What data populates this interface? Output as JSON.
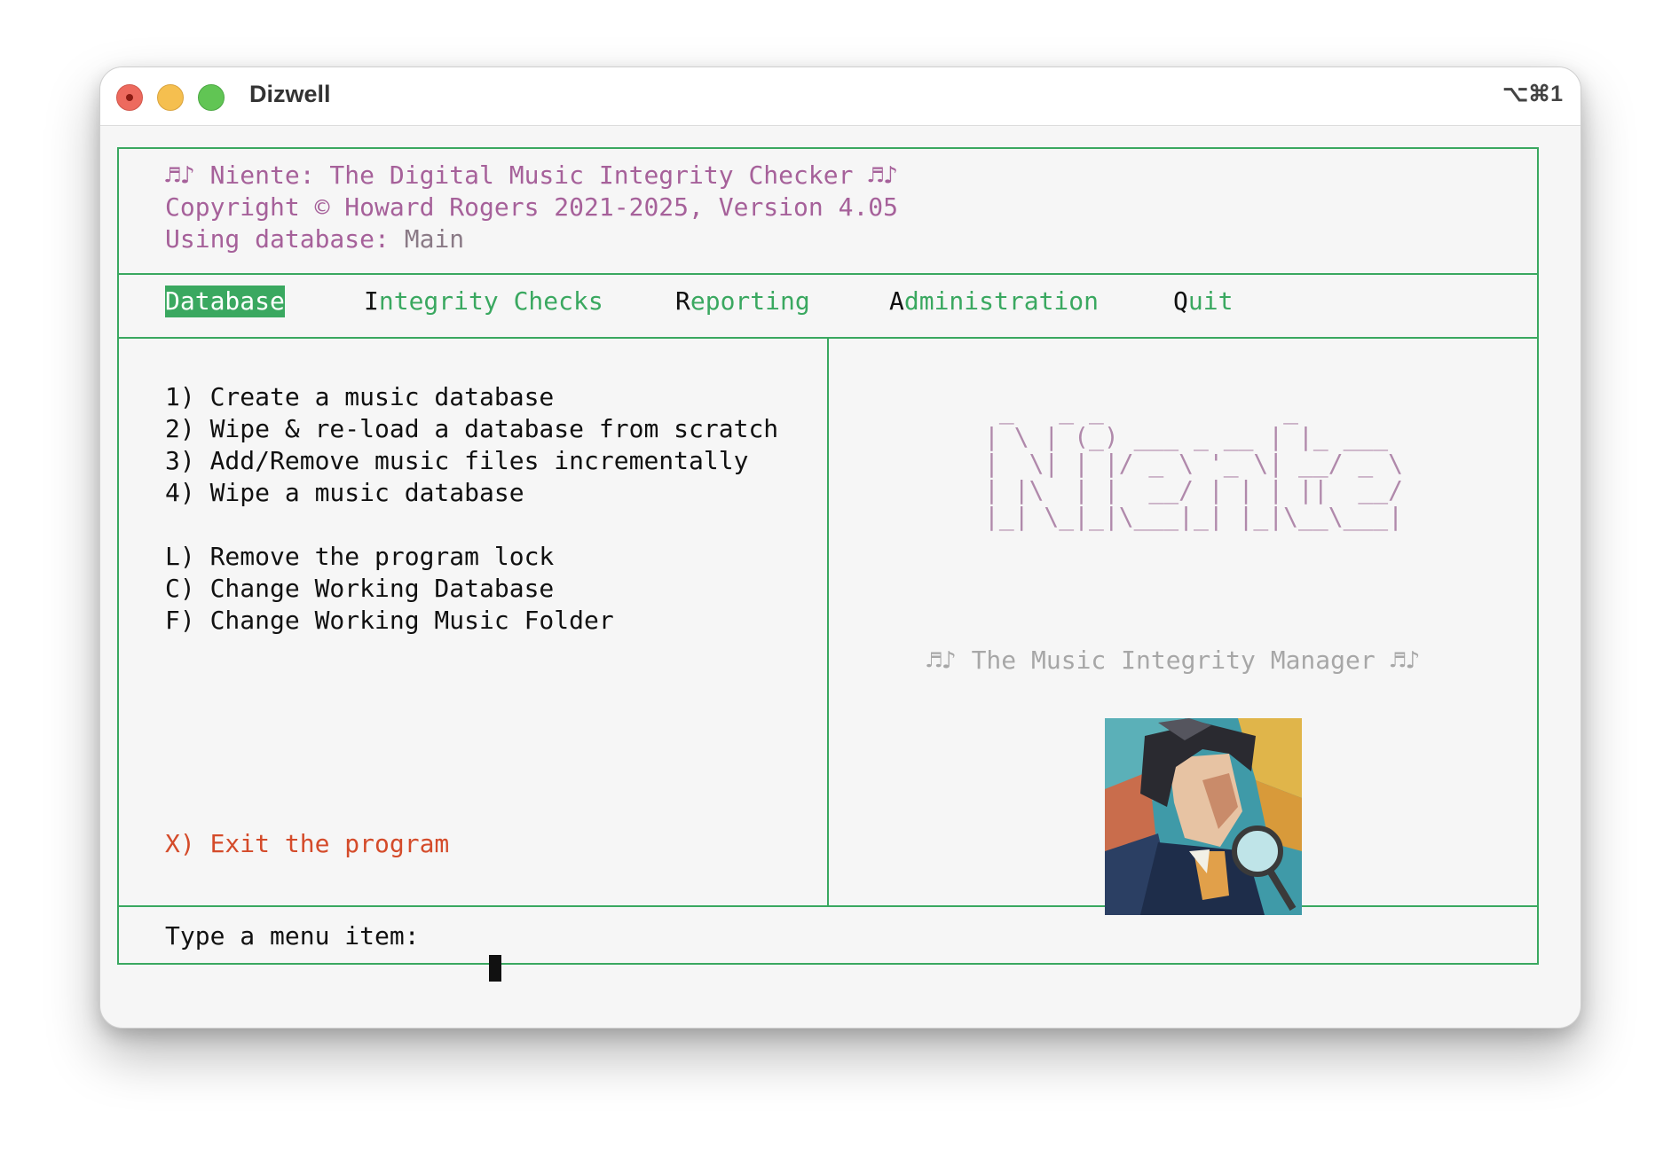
{
  "window": {
    "title": "Dizwell",
    "shortcut": "⌥⌘1"
  },
  "header": {
    "line1": "♬♪ Niente: The Digital Music Integrity Checker ♬♪",
    "line2": "Copyright © Howard Rogers 2021-2025, Version 4.05",
    "line3_label": "Using database:",
    "line3_value": "Main"
  },
  "menu": {
    "items": [
      {
        "key": "D",
        "rest": "atabase",
        "active": true
      },
      {
        "key": "I",
        "rest": "ntegrity Checks",
        "active": false
      },
      {
        "key": "R",
        "rest": "eporting",
        "active": false
      },
      {
        "key": "A",
        "rest": "dministration",
        "active": false
      },
      {
        "key": "Q",
        "rest": "uit",
        "active": false
      }
    ]
  },
  "options": [
    "1) Create a music database",
    "2) Wipe & re-load a database from scratch",
    "3) Add/Remove music files incrementally",
    "4) Wipe a music database",
    "L) Remove the program lock",
    "C) Change Working Database",
    "F) Change Working Music Folder"
  ],
  "exit_option": "X) Exit the program",
  "banner": {
    "ascii_art": " _   _ _            _       \n| \\ | (_) ___ _ __ | |_ ___ \n|  \\| | |/ _ \\ '_ \\| __/ _ \\\n| |\\  | |  __/ | | | ||  __/\n|_| \\_|_|\\___|_| |_|\\__\\___|",
    "tagline": "♬♪ The Music Integrity Manager ♬♪"
  },
  "prompt": {
    "label": "Type a menu item:"
  },
  "colors": {
    "border": "#3aa860",
    "header_text": "#a6619a",
    "exit_text": "#d44b2a",
    "menu_text": "#3aa860"
  }
}
